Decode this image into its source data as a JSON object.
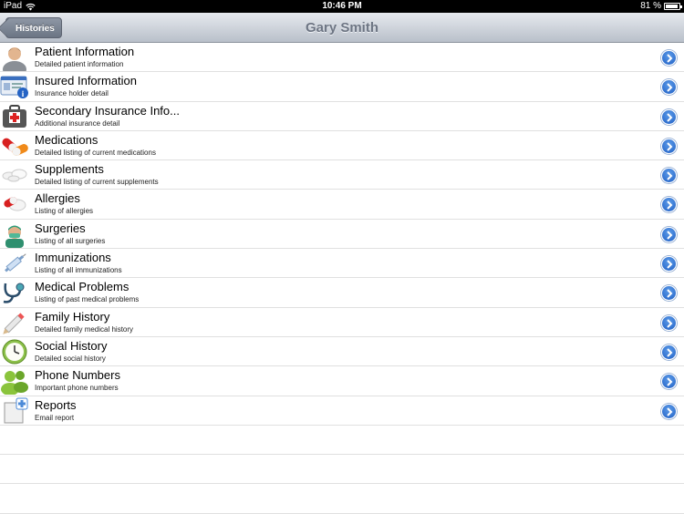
{
  "statusbar": {
    "carrier": "iPad",
    "time": "10:46 PM",
    "battery": "81 %",
    "battery_level": 0.81
  },
  "navbar": {
    "back_label": "Histories",
    "title": "Gary Smith"
  },
  "items": [
    {
      "title": "Patient Information",
      "subtitle": "Detailed patient information",
      "icon": "patient-icon"
    },
    {
      "title": "Insured Information",
      "subtitle": "Insurance holder detail",
      "icon": "insurance-card-icon"
    },
    {
      "title": "Secondary Insurance Info...",
      "subtitle": "Additional insurance detail",
      "icon": "medical-kit-icon"
    },
    {
      "title": "Medications",
      "subtitle": "Detailed listing of current medications",
      "icon": "pills-icon"
    },
    {
      "title": "Supplements",
      "subtitle": "Detailed listing of current supplements",
      "icon": "tablets-icon"
    },
    {
      "title": "Allergies",
      "subtitle": "Listing of allergies",
      "icon": "allergy-pills-icon"
    },
    {
      "title": "Surgeries",
      "subtitle": "Listing of all surgeries",
      "icon": "surgeon-icon"
    },
    {
      "title": "Immunizations",
      "subtitle": "Listing of all immunizations",
      "icon": "syringe-icon"
    },
    {
      "title": "Medical Problems",
      "subtitle": "Listing of past medical problems",
      "icon": "stethoscope-icon"
    },
    {
      "title": "Family History",
      "subtitle": "Detailed family medical history",
      "icon": "pencil-icon"
    },
    {
      "title": "Social History",
      "subtitle": "Detailed social history",
      "icon": "clock-icon"
    },
    {
      "title": "Phone Numbers",
      "subtitle": "Important phone numbers",
      "icon": "contacts-icon"
    },
    {
      "title": "Reports",
      "subtitle": "Email report",
      "icon": "new-report-icon"
    }
  ]
}
